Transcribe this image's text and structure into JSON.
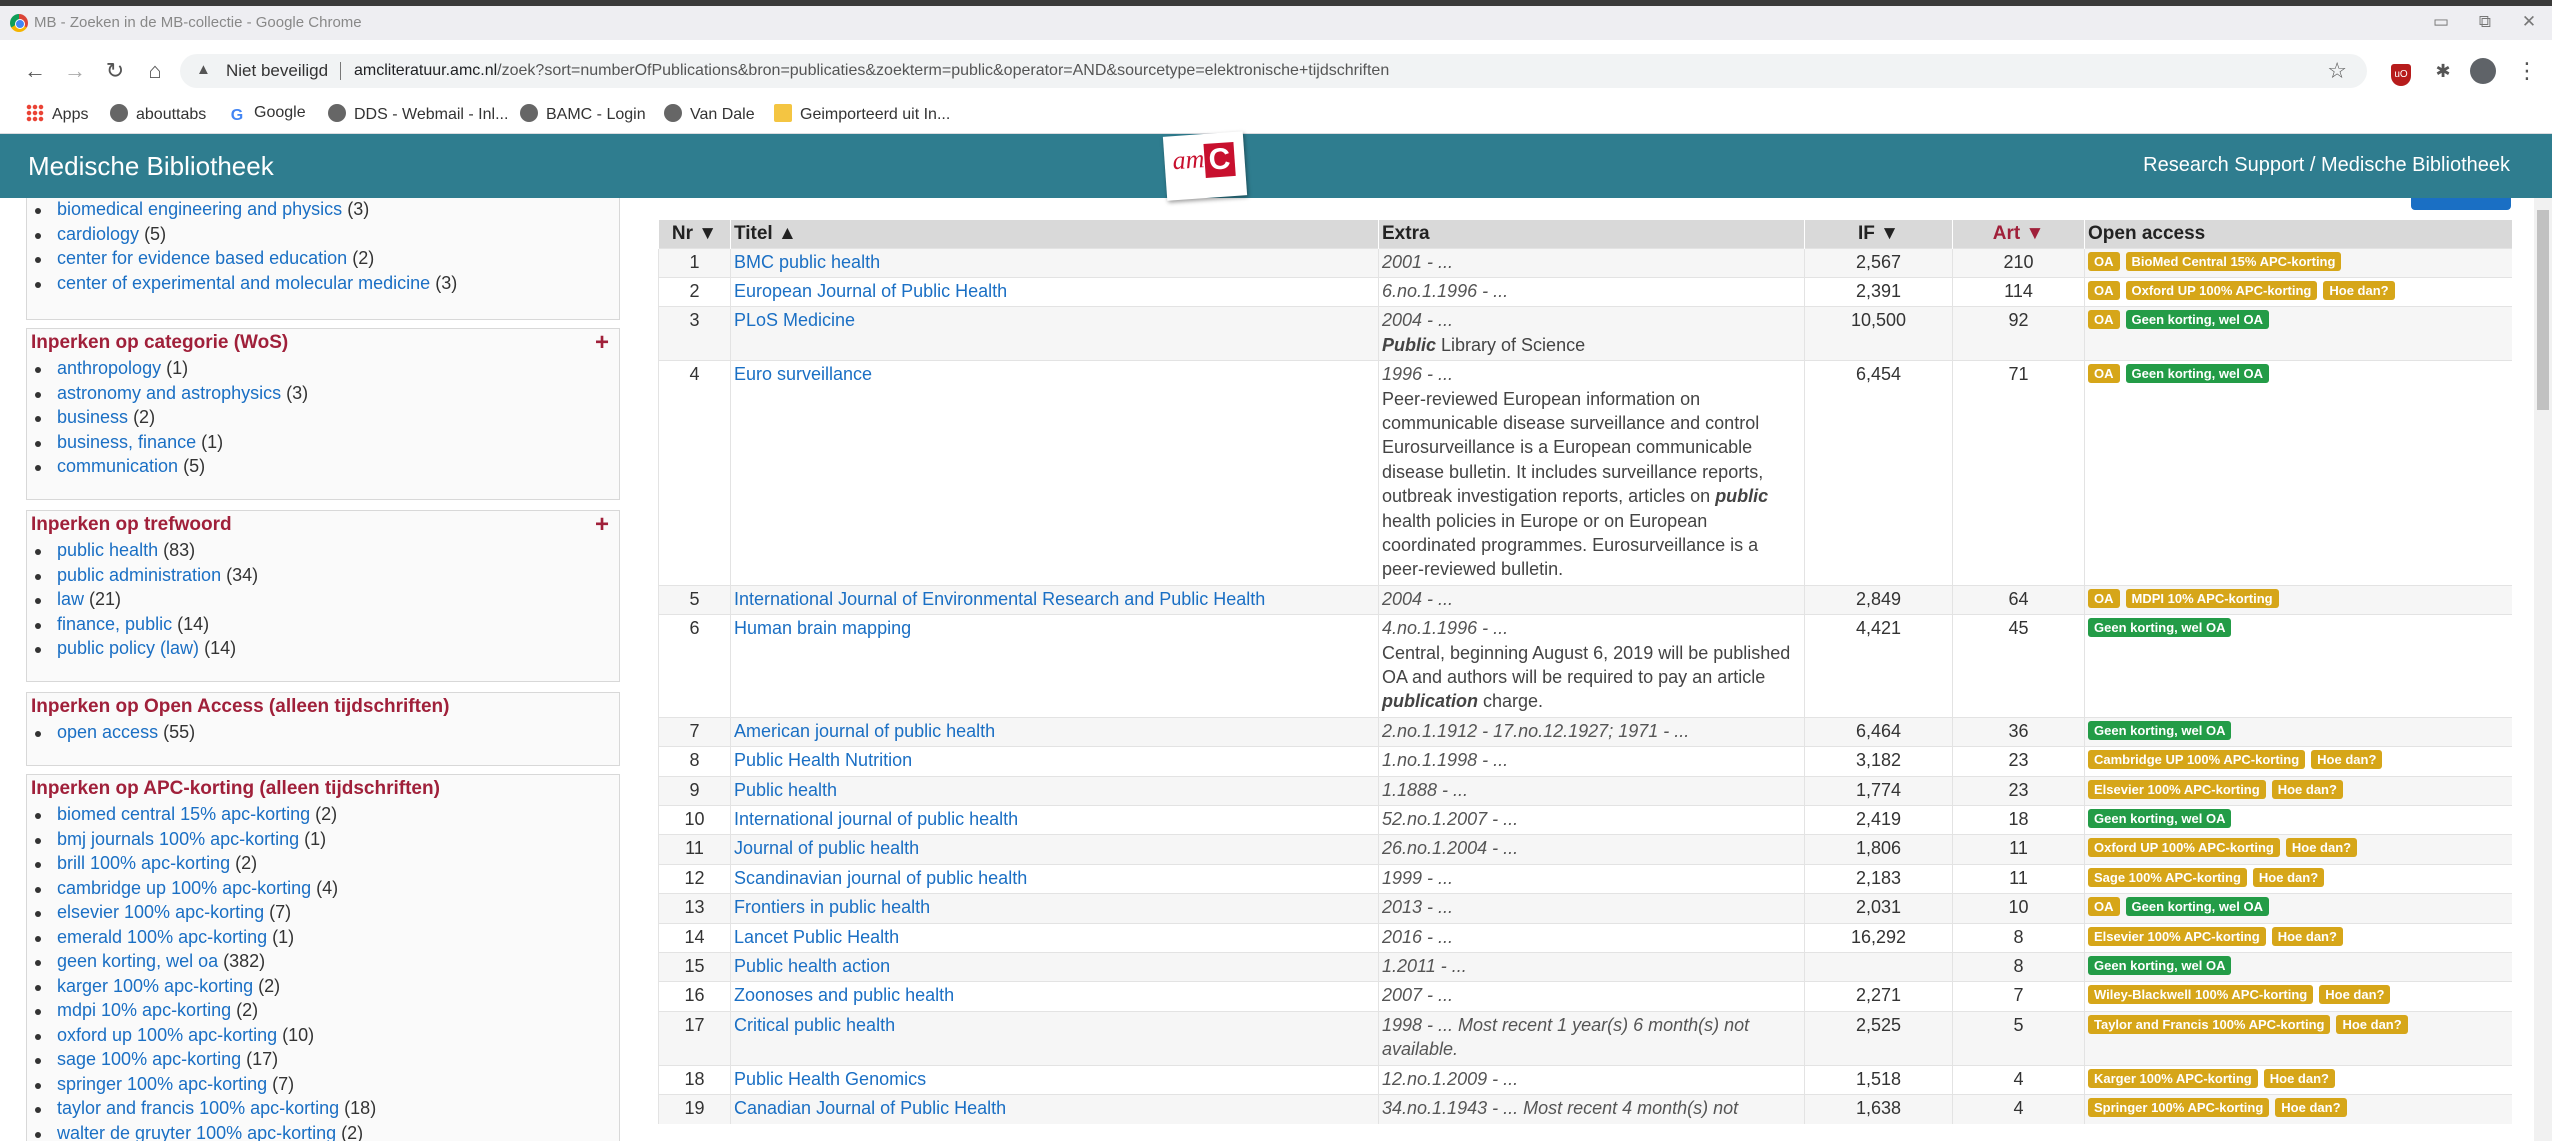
{
  "window": {
    "title": "MB - Zoeken in de MB-collectie - Google Chrome",
    "min": "▭",
    "max": "⧉",
    "close": "✕"
  },
  "toolbar": {
    "back": "←",
    "forward": "→",
    "reload": "↻",
    "home": "⌂",
    "security": "Niet beveiligd",
    "url_host": "amcliteratuur.amc.nl",
    "url_path": "/zoek?sort=numberOfPublications&bron=publicaties&zoekterm=public&operator=AND&sourcetype=elektronische+tijdschriften",
    "star": "☆",
    "puzzle": "✱",
    "menu": "⋮",
    "ublock": "uO"
  },
  "bookmarks": [
    {
      "label": "Apps",
      "icon": "apps-grid-icon"
    },
    {
      "label": "abouttabs",
      "icon": "globe-icon"
    },
    {
      "label": "Google",
      "icon": "google-icon"
    },
    {
      "label": "DDS - Webmail - Inl...",
      "icon": "globe-icon"
    },
    {
      "label": "BAMC - Login",
      "icon": "globe-icon"
    },
    {
      "label": "Van Dale",
      "icon": "globe-icon"
    },
    {
      "label": "Geimporteerd uit In...",
      "icon": "folder-icon"
    }
  ],
  "site": {
    "brand": "Medische Bibliotheek",
    "breadcrumb": "Research Support / Medische Bibliotheek",
    "logo_am": "am",
    "logo_c": "C"
  },
  "sidebar": {
    "dept_items": [
      {
        "label": "biomedical engineering and physics",
        "count": "(3)"
      },
      {
        "label": "cardiology",
        "count": "(5)"
      },
      {
        "label": "center for evidence based education",
        "count": "(2)"
      },
      {
        "label": "center of experimental and molecular medicine",
        "count": "(3)"
      }
    ],
    "category": {
      "title": "Inperken op categorie (WoS)",
      "items": [
        {
          "label": "anthropology",
          "count": "(1)"
        },
        {
          "label": "astronomy and astrophysics",
          "count": "(3)"
        },
        {
          "label": "business",
          "count": "(2)"
        },
        {
          "label": "business, finance",
          "count": "(1)"
        },
        {
          "label": "communication",
          "count": "(5)"
        }
      ]
    },
    "keyword": {
      "title": "Inperken op trefwoord",
      "items": [
        {
          "label": "public health",
          "count": "(83)"
        },
        {
          "label": "public administration",
          "count": "(34)"
        },
        {
          "label": "law",
          "count": "(21)"
        },
        {
          "label": "finance, public",
          "count": "(14)"
        },
        {
          "label": "public policy (law)",
          "count": "(14)"
        }
      ]
    },
    "openaccess": {
      "title": "Inperken op Open Access (alleen tijdschriften)",
      "items": [
        {
          "label": "open access",
          "count": "(55)"
        }
      ]
    },
    "apc": {
      "title": "Inperken op APC-korting (alleen tijdschriften)",
      "items": [
        {
          "label": "biomed central 15% apc-korting",
          "count": "(2)"
        },
        {
          "label": "bmj journals 100% apc-korting",
          "count": "(1)"
        },
        {
          "label": "brill 100% apc-korting",
          "count": "(2)"
        },
        {
          "label": "cambridge up 100% apc-korting",
          "count": "(4)"
        },
        {
          "label": "elsevier 100% apc-korting",
          "count": "(7)"
        },
        {
          "label": "emerald 100% apc-korting",
          "count": "(1)"
        },
        {
          "label": "geen korting, wel oa",
          "count": "(382)"
        },
        {
          "label": "karger 100% apc-korting",
          "count": "(2)"
        },
        {
          "label": "mdpi 10% apc-korting",
          "count": "(2)"
        },
        {
          "label": "oxford up 100% apc-korting",
          "count": "(10)"
        },
        {
          "label": "sage 100% apc-korting",
          "count": "(17)"
        },
        {
          "label": "springer 100% apc-korting",
          "count": "(7)"
        },
        {
          "label": "taylor and francis 100% apc-korting",
          "count": "(18)"
        },
        {
          "label": "walter de gruyter 100% apc-korting",
          "count": "(2)"
        }
      ]
    },
    "plus": "+"
  },
  "table": {
    "headers": {
      "nr": "Nr ▼",
      "title": "Titel ▲",
      "extra": "Extra",
      "if": "IF ▼",
      "art": "Art ▼",
      "oa": "Open access"
    },
    "rows": [
      {
        "nr": "1",
        "title": "BMC public health",
        "period": "2001 - ...",
        "desc": "",
        "if": "2,567",
        "art": "210",
        "badges": [
          {
            "t": "OA",
            "c": "yellow"
          },
          {
            "t": "BioMed Central 15% APC-korting",
            "c": "yellow"
          }
        ]
      },
      {
        "nr": "2",
        "title": "European Journal of Public Health",
        "period": "6.no.1.1996 - ...",
        "desc": "",
        "if": "2,391",
        "art": "114",
        "badges": [
          {
            "t": "OA",
            "c": "yellow"
          },
          {
            "t": "Oxford UP 100% APC-korting",
            "c": "yellow"
          },
          {
            "t": "Hoe dan?",
            "c": "yellow"
          }
        ]
      },
      {
        "nr": "3",
        "title": "PLoS Medicine",
        "period": "2004 - ...",
        "desc": "<b><i>Public</i></b> Library of Science",
        "if": "10,500",
        "art": "92",
        "badges": [
          {
            "t": "OA",
            "c": "yellow"
          },
          {
            "t": "Geen korting, wel OA",
            "c": "green"
          }
        ]
      },
      {
        "nr": "4",
        "title": "Euro surveillance",
        "period": "1996 - ...",
        "desc": "Peer-reviewed European information on communicable disease surveillance and control Eurosurveillance is a European communicable disease bulletin. It includes surveillance reports, outbreak investigation reports, articles on <b><i>public</i></b> health policies in Europe or on European coordinated programmes. Eurosurveillance is a peer-reviewed bulletin.",
        "if": "6,454",
        "art": "71",
        "badges": [
          {
            "t": "OA",
            "c": "yellow"
          },
          {
            "t": "Geen korting, wel OA",
            "c": "green"
          }
        ]
      },
      {
        "nr": "5",
        "title": "International Journal of Environmental Research and Public Health",
        "period": "2004 - ...",
        "desc": "",
        "if": "2,849",
        "art": "64",
        "badges": [
          {
            "t": "OA",
            "c": "yellow"
          },
          {
            "t": "MDPI 10% APC-korting",
            "c": "yellow"
          }
        ]
      },
      {
        "nr": "6",
        "title": "Human brain mapping",
        "period": "4.no.1.1996 - ...",
        "desc": "Central, beginning August 6, 2019 will be published OA and authors will be required to pay an article <b><i>publication</i></b> charge.",
        "if": "4,421",
        "art": "45",
        "badges": [
          {
            "t": "Geen korting, wel OA",
            "c": "green"
          }
        ]
      },
      {
        "nr": "7",
        "title": "American journal of public health",
        "period": "2.no.1.1912 - 17.no.12.1927; 1971 - ...",
        "desc": "",
        "if": "6,464",
        "art": "36",
        "badges": [
          {
            "t": "Geen korting, wel OA",
            "c": "green"
          }
        ]
      },
      {
        "nr": "8",
        "title": "Public Health Nutrition",
        "period": "1.no.1.1998 - ...",
        "desc": "",
        "if": "3,182",
        "art": "23",
        "badges": [
          {
            "t": "Cambridge UP 100% APC-korting",
            "c": "yellow"
          },
          {
            "t": "Hoe dan?",
            "c": "yellow"
          }
        ]
      },
      {
        "nr": "9",
        "title": "Public health",
        "period": "1.1888 - ...",
        "desc": "",
        "if": "1,774",
        "art": "23",
        "badges": [
          {
            "t": "Elsevier 100% APC-korting",
            "c": "yellow"
          },
          {
            "t": "Hoe dan?",
            "c": "yellow"
          }
        ]
      },
      {
        "nr": "10",
        "title": "International journal of public health",
        "period": "52.no.1.2007 - ...",
        "desc": "",
        "if": "2,419",
        "art": "18",
        "badges": [
          {
            "t": "Geen korting, wel OA",
            "c": "green"
          }
        ]
      },
      {
        "nr": "11",
        "title": "Journal of public health",
        "period": "26.no.1.2004 - ...",
        "desc": "",
        "if": "1,806",
        "art": "11",
        "badges": [
          {
            "t": "Oxford UP 100% APC-korting",
            "c": "yellow"
          },
          {
            "t": "Hoe dan?",
            "c": "yellow"
          }
        ]
      },
      {
        "nr": "12",
        "title": "Scandinavian journal of public health",
        "period": "1999 - ...",
        "desc": "",
        "if": "2,183",
        "art": "11",
        "badges": [
          {
            "t": "Sage 100% APC-korting",
            "c": "yellow"
          },
          {
            "t": "Hoe dan?",
            "c": "yellow"
          }
        ]
      },
      {
        "nr": "13",
        "title": "Frontiers in public health",
        "period": "2013 - ...",
        "desc": "",
        "if": "2,031",
        "art": "10",
        "badges": [
          {
            "t": "OA",
            "c": "yellow"
          },
          {
            "t": "Geen korting, wel OA",
            "c": "green"
          }
        ]
      },
      {
        "nr": "14",
        "title": "Lancet Public Health",
        "period": "2016 - ...",
        "desc": "",
        "if": "16,292",
        "art": "8",
        "badges": [
          {
            "t": "Elsevier 100% APC-korting",
            "c": "yellow"
          },
          {
            "t": "Hoe dan?",
            "c": "yellow"
          }
        ]
      },
      {
        "nr": "15",
        "title": "Public health action",
        "period": "1.2011 - ...",
        "desc": "",
        "if": "",
        "art": "8",
        "badges": [
          {
            "t": "Geen korting, wel OA",
            "c": "green"
          }
        ]
      },
      {
        "nr": "16",
        "title": "Zoonoses and public health",
        "period": "2007 - ...",
        "desc": "",
        "if": "2,271",
        "art": "7",
        "badges": [
          {
            "t": "Wiley-Blackwell 100% APC-korting",
            "c": "yellow"
          },
          {
            "t": "Hoe dan?",
            "c": "yellow"
          }
        ]
      },
      {
        "nr": "17",
        "title": "Critical public health",
        "period": "1998 - ... Most recent 1 year(s) 6 month(s) not available.",
        "desc": "",
        "if": "2,525",
        "art": "5",
        "badges": [
          {
            "t": "Taylor and Francis 100% APC-korting",
            "c": "yellow"
          },
          {
            "t": "Hoe dan?",
            "c": "yellow"
          }
        ]
      },
      {
        "nr": "18",
        "title": "Public Health Genomics",
        "period": "12.no.1.2009 - ...",
        "desc": "",
        "if": "1,518",
        "art": "4",
        "badges": [
          {
            "t": "Karger 100% APC-korting",
            "c": "yellow"
          },
          {
            "t": "Hoe dan?",
            "c": "yellow"
          }
        ]
      },
      {
        "nr": "19",
        "title": "Canadian Journal of Public Health",
        "period": "34.no.1.1943 - ... Most recent 4 month(s) not",
        "desc": "",
        "if": "1,638",
        "art": "4",
        "badges": [
          {
            "t": "Springer 100% APC-korting",
            "c": "yellow"
          },
          {
            "t": "Hoe dan?",
            "c": "yellow"
          }
        ]
      }
    ]
  },
  "colors": {
    "header_teal": "#2f7d8f",
    "facet_red": "#a0203a",
    "link_blue": "#1a6fc4",
    "badge_yellow": "#d6a619",
    "badge_green": "#239c47"
  }
}
